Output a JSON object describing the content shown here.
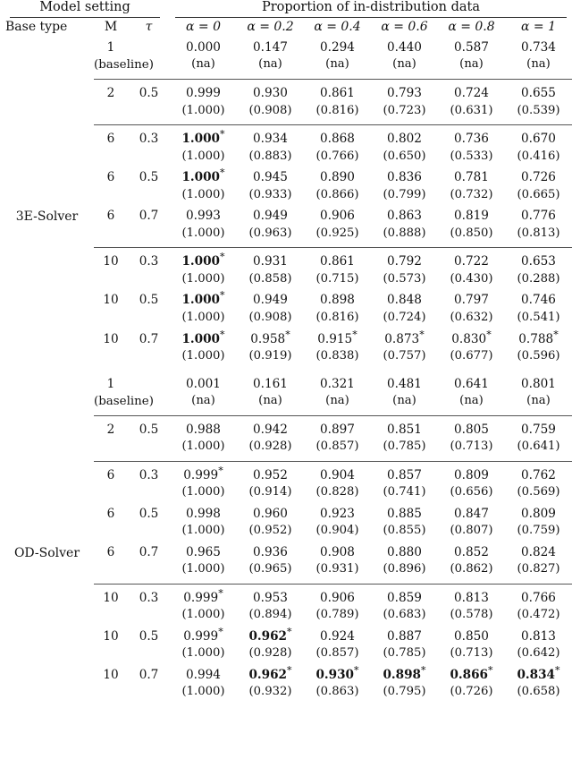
{
  "table": {
    "group_headers": {
      "model_setting": "Model setting",
      "proportion": "Proportion of in-distribution data"
    },
    "columns": {
      "base_type": "Base type",
      "m": "M",
      "tau": "τ",
      "alpha": [
        "α = 0",
        "α = 0.2",
        "α = 0.4",
        "α = 0.6",
        "α = 0.8",
        "α = 1"
      ]
    },
    "sections": [
      {
        "base_type": "3E-Solver",
        "blocks": [
          {
            "rows": [
              {
                "m": "1",
                "m2": "(baseline)",
                "tau": "",
                "main": [
                  "0.000",
                  "0.147",
                  "0.294",
                  "0.440",
                  "0.587",
                  "0.734"
                ],
                "main_bold": [
                  false,
                  false,
                  false,
                  false,
                  false,
                  false
                ],
                "main_star": [
                  false,
                  false,
                  false,
                  false,
                  false,
                  false
                ],
                "sub": [
                  "(na)",
                  "(na)",
                  "(na)",
                  "(na)",
                  "(na)",
                  "(na)"
                ]
              }
            ]
          },
          {
            "rows": [
              {
                "m": "2",
                "tau": "0.5",
                "main": [
                  "0.999",
                  "0.930",
                  "0.861",
                  "0.793",
                  "0.724",
                  "0.655"
                ],
                "main_bold": [
                  false,
                  false,
                  false,
                  false,
                  false,
                  false
                ],
                "main_star": [
                  false,
                  false,
                  false,
                  false,
                  false,
                  false
                ],
                "sub": [
                  "(1.000)",
                  "(0.908)",
                  "(0.816)",
                  "(0.723)",
                  "(0.631)",
                  "(0.539)"
                ]
              }
            ]
          },
          {
            "rows": [
              {
                "m": "6",
                "tau": "0.3",
                "main": [
                  "1.000",
                  "0.934",
                  "0.868",
                  "0.802",
                  "0.736",
                  "0.670"
                ],
                "main_bold": [
                  true,
                  false,
                  false,
                  false,
                  false,
                  false
                ],
                "main_star": [
                  true,
                  false,
                  false,
                  false,
                  false,
                  false
                ],
                "sub": [
                  "(1.000)",
                  "(0.883)",
                  "(0.766)",
                  "(0.650)",
                  "(0.533)",
                  "(0.416)"
                ]
              },
              {
                "m": "6",
                "tau": "0.5",
                "main": [
                  "1.000",
                  "0.945",
                  "0.890",
                  "0.836",
                  "0.781",
                  "0.726"
                ],
                "main_bold": [
                  true,
                  false,
                  false,
                  false,
                  false,
                  false
                ],
                "main_star": [
                  true,
                  false,
                  false,
                  false,
                  false,
                  false
                ],
                "sub": [
                  "(1.000)",
                  "(0.933)",
                  "(0.866)",
                  "(0.799)",
                  "(0.732)",
                  "(0.665)"
                ]
              },
              {
                "m": "6",
                "tau": "0.7",
                "main": [
                  "0.993",
                  "0.949",
                  "0.906",
                  "0.863",
                  "0.819",
                  "0.776"
                ],
                "main_bold": [
                  false,
                  false,
                  false,
                  false,
                  false,
                  false
                ],
                "main_star": [
                  false,
                  false,
                  false,
                  false,
                  false,
                  false
                ],
                "sub": [
                  "(1.000)",
                  "(0.963)",
                  "(0.925)",
                  "(0.888)",
                  "(0.850)",
                  "(0.813)"
                ]
              }
            ]
          },
          {
            "rows": [
              {
                "m": "10",
                "tau": "0.3",
                "main": [
                  "1.000",
                  "0.931",
                  "0.861",
                  "0.792",
                  "0.722",
                  "0.653"
                ],
                "main_bold": [
                  true,
                  false,
                  false,
                  false,
                  false,
                  false
                ],
                "main_star": [
                  true,
                  false,
                  false,
                  false,
                  false,
                  false
                ],
                "sub": [
                  "(1.000)",
                  "(0.858)",
                  "(0.715)",
                  "(0.573)",
                  "(0.430)",
                  "(0.288)"
                ]
              },
              {
                "m": "10",
                "tau": "0.5",
                "main": [
                  "1.000",
                  "0.949",
                  "0.898",
                  "0.848",
                  "0.797",
                  "0.746"
                ],
                "main_bold": [
                  true,
                  false,
                  false,
                  false,
                  false,
                  false
                ],
                "main_star": [
                  true,
                  false,
                  false,
                  false,
                  false,
                  false
                ],
                "sub": [
                  "(1.000)",
                  "(0.908)",
                  "(0.816)",
                  "(0.724)",
                  "(0.632)",
                  "(0.541)"
                ]
              },
              {
                "m": "10",
                "tau": "0.7",
                "main": [
                  "1.000",
                  "0.958",
                  "0.915",
                  "0.873",
                  "0.830",
                  "0.788"
                ],
                "main_bold": [
                  true,
                  false,
                  false,
                  false,
                  false,
                  false
                ],
                "main_star": [
                  true,
                  true,
                  true,
                  true,
                  true,
                  true
                ],
                "sub": [
                  "(1.000)",
                  "(0.919)",
                  "(0.838)",
                  "(0.757)",
                  "(0.677)",
                  "(0.596)"
                ]
              }
            ]
          }
        ]
      },
      {
        "base_type": "OD-Solver",
        "blocks": [
          {
            "rows": [
              {
                "m": "1",
                "m2": "(baseline)",
                "tau": "",
                "main": [
                  "0.001",
                  "0.161",
                  "0.321",
                  "0.481",
                  "0.641",
                  "0.801"
                ],
                "main_bold": [
                  false,
                  false,
                  false,
                  false,
                  false,
                  false
                ],
                "main_star": [
                  false,
                  false,
                  false,
                  false,
                  false,
                  false
                ],
                "sub": [
                  "(na)",
                  "(na)",
                  "(na)",
                  "(na)",
                  "(na)",
                  "(na)"
                ]
              }
            ]
          },
          {
            "rows": [
              {
                "m": "2",
                "tau": "0.5",
                "main": [
                  "0.988",
                  "0.942",
                  "0.897",
                  "0.851",
                  "0.805",
                  "0.759"
                ],
                "main_bold": [
                  false,
                  false,
                  false,
                  false,
                  false,
                  false
                ],
                "main_star": [
                  false,
                  false,
                  false,
                  false,
                  false,
                  false
                ],
                "sub": [
                  "(1.000)",
                  "(0.928)",
                  "(0.857)",
                  "(0.785)",
                  "(0.713)",
                  "(0.641)"
                ]
              }
            ]
          },
          {
            "rows": [
              {
                "m": "6",
                "tau": "0.3",
                "main": [
                  "0.999",
                  "0.952",
                  "0.904",
                  "0.857",
                  "0.809",
                  "0.762"
                ],
                "main_bold": [
                  false,
                  false,
                  false,
                  false,
                  false,
                  false
                ],
                "main_star": [
                  true,
                  false,
                  false,
                  false,
                  false,
                  false
                ],
                "sub": [
                  "(1.000)",
                  "(0.914)",
                  "(0.828)",
                  "(0.741)",
                  "(0.656)",
                  "(0.569)"
                ]
              },
              {
                "m": "6",
                "tau": "0.5",
                "main": [
                  "0.998",
                  "0.960",
                  "0.923",
                  "0.885",
                  "0.847",
                  "0.809"
                ],
                "main_bold": [
                  false,
                  false,
                  false,
                  false,
                  false,
                  false
                ],
                "main_star": [
                  false,
                  false,
                  false,
                  false,
                  false,
                  false
                ],
                "sub": [
                  "(1.000)",
                  "(0.952)",
                  "(0.904)",
                  "(0.855)",
                  "(0.807)",
                  "(0.759)"
                ]
              },
              {
                "m": "6",
                "tau": "0.7",
                "main": [
                  "0.965",
                  "0.936",
                  "0.908",
                  "0.880",
                  "0.852",
                  "0.824"
                ],
                "main_bold": [
                  false,
                  false,
                  false,
                  false,
                  false,
                  false
                ],
                "main_star": [
                  false,
                  false,
                  false,
                  false,
                  false,
                  false
                ],
                "sub": [
                  "(1.000)",
                  "(0.965)",
                  "(0.931)",
                  "(0.896)",
                  "(0.862)",
                  "(0.827)"
                ]
              }
            ]
          },
          {
            "rows": [
              {
                "m": "10",
                "tau": "0.3",
                "main": [
                  "0.999",
                  "0.953",
                  "0.906",
                  "0.859",
                  "0.813",
                  "0.766"
                ],
                "main_bold": [
                  false,
                  false,
                  false,
                  false,
                  false,
                  false
                ],
                "main_star": [
                  true,
                  false,
                  false,
                  false,
                  false,
                  false
                ],
                "sub": [
                  "(1.000)",
                  "(0.894)",
                  "(0.789)",
                  "(0.683)",
                  "(0.578)",
                  "(0.472)"
                ]
              },
              {
                "m": "10",
                "tau": "0.5",
                "main": [
                  "0.999",
                  "0.962",
                  "0.924",
                  "0.887",
                  "0.850",
                  "0.813"
                ],
                "main_bold": [
                  false,
                  true,
                  false,
                  false,
                  false,
                  false
                ],
                "main_star": [
                  true,
                  true,
                  false,
                  false,
                  false,
                  false
                ],
                "sub": [
                  "(1.000)",
                  "(0.928)",
                  "(0.857)",
                  "(0.785)",
                  "(0.713)",
                  "(0.642)"
                ]
              },
              {
                "m": "10",
                "tau": "0.7",
                "main": [
                  "0.994",
                  "0.962",
                  "0.930",
                  "0.898",
                  "0.866",
                  "0.834"
                ],
                "main_bold": [
                  false,
                  true,
                  true,
                  true,
                  true,
                  true
                ],
                "main_star": [
                  false,
                  true,
                  true,
                  true,
                  true,
                  true
                ],
                "sub": [
                  "(1.000)",
                  "(0.932)",
                  "(0.863)",
                  "(0.795)",
                  "(0.726)",
                  "(0.658)"
                ]
              }
            ]
          }
        ]
      }
    ]
  }
}
